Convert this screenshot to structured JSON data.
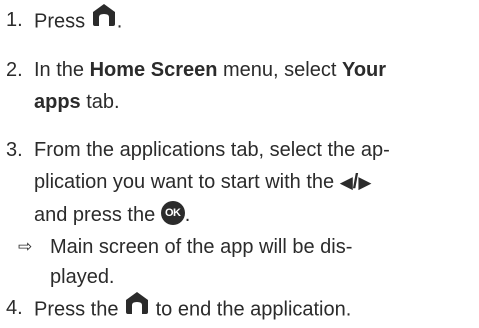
{
  "steps": [
    {
      "number": "1.",
      "text_before": "Press",
      "text_after": "."
    },
    {
      "number": "2.",
      "text_1": "In the ",
      "bold_1": "Home Screen",
      "text_2": " menu, select ",
      "bold_2": "Your",
      "bold_3": "apps",
      "text_3": " tab."
    },
    {
      "number": "3.",
      "line_1": "From the applications tab, select the ap-",
      "line_2_before": "plication you want to start with the ",
      "arrows_left": "◀",
      "arrows_sep": "/",
      "arrows_right": "▶",
      "line_3_before": "and press the ",
      "ok_label": "OK",
      "line_3_after": "."
    },
    {
      "number": "4.",
      "text_before": "Press the ",
      "text_after": " to end the application."
    }
  ],
  "result": {
    "arrow": "⇨",
    "line_1": "Main screen of the app will be dis-",
    "line_2": "played."
  },
  "icons": {
    "home": "home-icon",
    "ok": "ok-button-icon",
    "result_arrow": "result-arrow-icon"
  }
}
